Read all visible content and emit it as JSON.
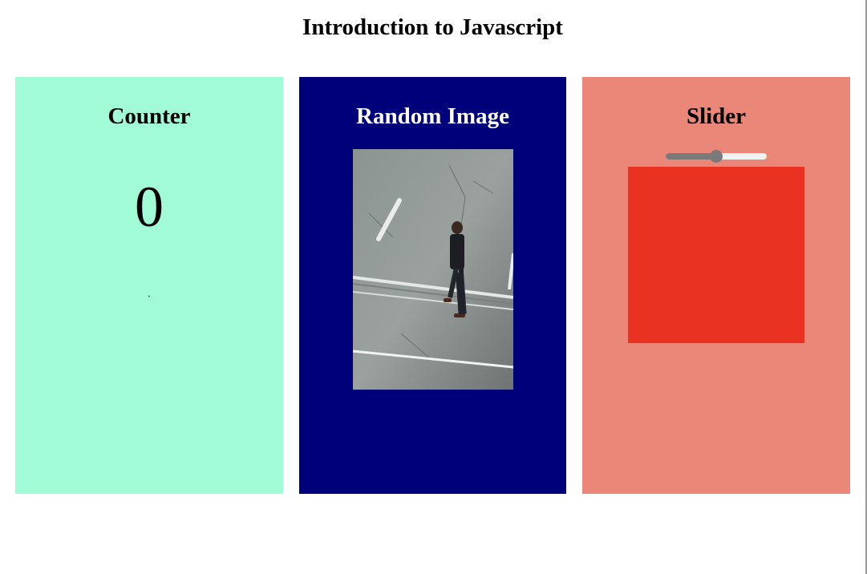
{
  "page": {
    "title": "Introduction to Javascript"
  },
  "counter_card": {
    "title": "Counter",
    "value": "0",
    "tick": "`",
    "background": "#a1fbd6"
  },
  "image_card": {
    "title": "Random Image",
    "background": "#00007a",
    "title_color": "#ffffff",
    "image_alt": "person walking on road"
  },
  "slider_card": {
    "title": "Slider",
    "background": "#eb8778",
    "slider_value_fraction": 0.5,
    "box_color": "#ea3223"
  }
}
